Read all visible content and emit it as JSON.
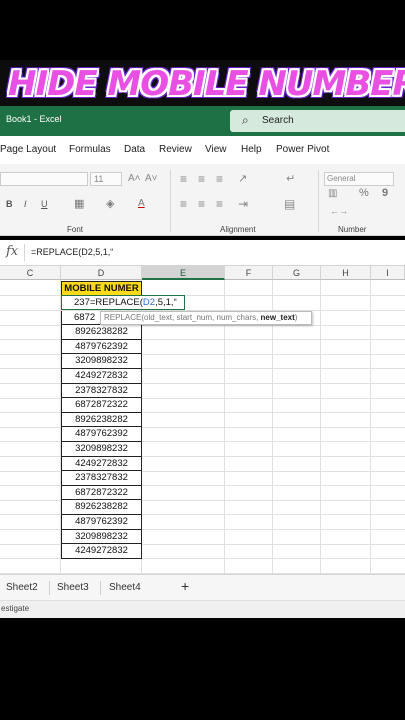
{
  "banner": {
    "title": "HIDE MOBILE NUMBER"
  },
  "window": {
    "title": "Book1 - Excel",
    "search_label": "Search"
  },
  "menu": [
    "Page Layout",
    "Formulas",
    "Data",
    "Review",
    "View",
    "Help",
    "Power Pivot"
  ],
  "ribbon": {
    "font_group": "Font",
    "alignment_group": "Alignment",
    "number_group": "Number",
    "font_size": "11",
    "number_format": "General",
    "bold": "B",
    "italic": "I",
    "underline": "U",
    "grow_font": "A˄",
    "shrink_font": "A˅",
    "font_color": "A",
    "percent": "%",
    "comma": "9"
  },
  "formula_bar": {
    "fx_label": "fx",
    "content": "=REPLACE(D2,5,1,“"
  },
  "grid": {
    "columns": [
      "C",
      "D",
      "E",
      "F",
      "G",
      "H",
      "I"
    ],
    "header_cell": "MOBILE NUMER",
    "edit_prefix": "237",
    "edit_func": "=REPLACE(",
    "edit_ref": "D2",
    "edit_args": ",5,1,“",
    "partial_row": "6872",
    "rows": [
      "8926238282",
      "4879762392",
      "3209898232",
      "4249272832",
      "2378327832",
      "6872872322",
      "8926238282",
      "4879762392",
      "3209898232",
      "4249272832",
      "2378327832",
      "6872872322",
      "8926238282",
      "4879762392",
      "3209898232",
      "4249272832"
    ],
    "tooltip": {
      "prefix": "REPLACE(old_text, start_num, num_chars, ",
      "current": "new_text",
      "suffix": ")"
    }
  },
  "sheets": [
    "Sheet2",
    "Sheet3",
    "Sheet4"
  ],
  "add_sheet": "+",
  "status": "estigate"
}
